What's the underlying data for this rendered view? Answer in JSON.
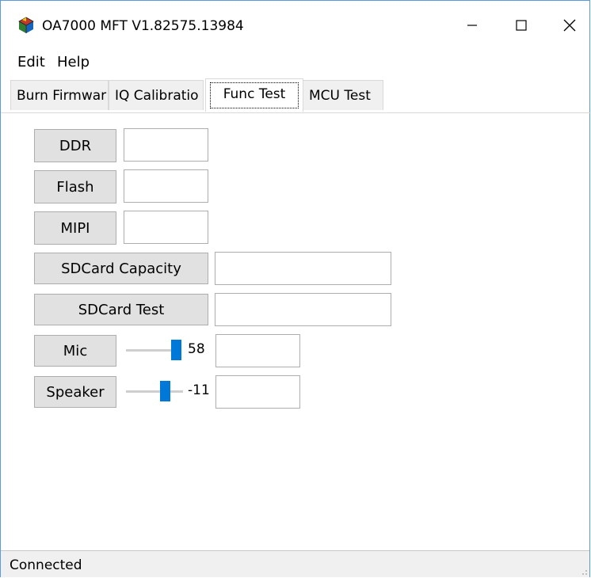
{
  "window": {
    "title": "OA7000 MFT V1.82575.13984",
    "icon": "app-cube-icon",
    "controls": [
      "minimize-icon",
      "maximize-icon",
      "close-icon"
    ]
  },
  "menu": {
    "items": [
      {
        "label": "Edit"
      },
      {
        "label": "Help"
      }
    ]
  },
  "tabs": [
    {
      "label": "Burn Firmwar"
    },
    {
      "label": "IQ Calibratio"
    },
    {
      "label": "Func Test",
      "active": true
    },
    {
      "label": "MCU Test"
    }
  ],
  "func_test": {
    "ddr": {
      "button": "DDR",
      "value": ""
    },
    "flash": {
      "button": "Flash",
      "value": ""
    },
    "mipi": {
      "button": "MIPI",
      "value": ""
    },
    "sdcard_capacity": {
      "button": "SDCard Capacity",
      "value": ""
    },
    "sdcard_test": {
      "button": "SDCard Test",
      "value": ""
    },
    "mic": {
      "button": "Mic",
      "slider_value": "58",
      "value": ""
    },
    "speaker": {
      "button": "Speaker",
      "slider_value": "-11",
      "value": ""
    }
  },
  "status": {
    "text": "Connected"
  },
  "colors": {
    "accent": "#0078d7",
    "button_face": "#e1e1e1",
    "tab_inactive": "#f0f0f0",
    "window_border": "#5a9be0"
  }
}
